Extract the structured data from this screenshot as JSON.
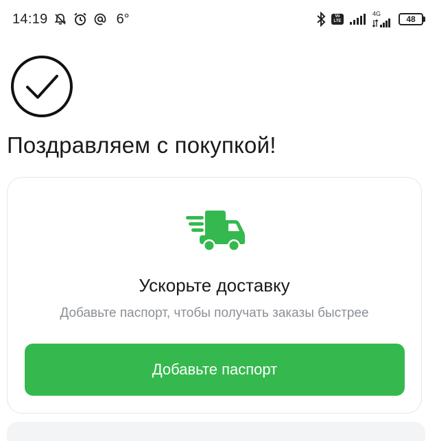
{
  "status_bar": {
    "time": "14:19",
    "temperature": "6°",
    "network": "4G",
    "battery": "48",
    "icons": [
      "bell-off-icon",
      "alarm-icon",
      "at-icon",
      "bluetooth-icon",
      "volte-icon",
      "signal-icon",
      "signal-icon",
      "battery-icon"
    ]
  },
  "success_icon": "check-circle-icon",
  "title": "Поздравляем с покупкой!",
  "card": {
    "icon": "delivery-truck-icon",
    "title": "Ускорьте доставку",
    "subtitle": "Добавьте паспорт, чтобы получать заказы быстрее",
    "button_label": "Добавьте паспорт"
  },
  "colors": {
    "accent": "#35b94f",
    "text": "#1a1a1a",
    "muted": "#8a8f96",
    "border": "#e4e6e8"
  }
}
